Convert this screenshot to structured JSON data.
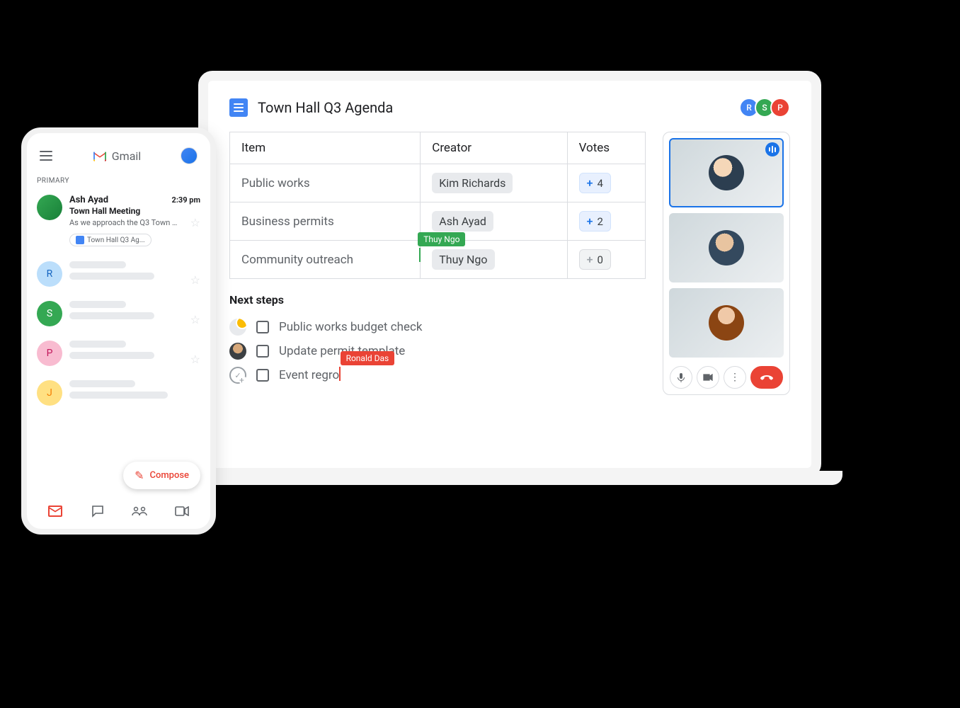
{
  "gmail": {
    "brand": "Gmail",
    "tab": "PRIMARY",
    "compose": "Compose",
    "email": {
      "sender": "Ash Ayad",
      "time": "2:39 pm",
      "subject": "Town Hall Meeting",
      "snippet": "As we approach the Q3 Town Ha...",
      "attachment": "Town Hall Q3 Ag..."
    },
    "placeholders": [
      "R",
      "S",
      "P",
      "J"
    ]
  },
  "doc": {
    "title": "Town Hall Q3 Agenda",
    "collaborators": [
      "R",
      "S",
      "P"
    ],
    "table": {
      "headers": {
        "item": "Item",
        "creator": "Creator",
        "votes": "Votes"
      },
      "rows": [
        {
          "item": "Public works",
          "creator": "Kim Richards",
          "votes": "4"
        },
        {
          "item": "Business permits",
          "creator": "Ash Ayad",
          "votes": "2"
        },
        {
          "item": "Community outreach",
          "creator": "Thuy Ngo",
          "votes": "0"
        }
      ]
    },
    "cursors": {
      "green": "Thuy Ngo",
      "red": "Ronald Das"
    },
    "next_steps": {
      "heading": "Next steps",
      "items": [
        "Public works budget check",
        "Update permit template",
        "Event regro"
      ]
    }
  },
  "vote_plus": "+"
}
